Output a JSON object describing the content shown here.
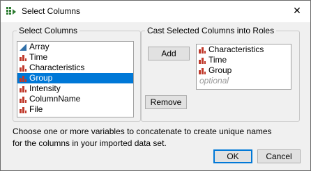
{
  "window": {
    "title": "Select Columns",
    "close_glyph": "✕"
  },
  "select_columns": {
    "label": "Select Columns",
    "items": [
      {
        "label": "Array",
        "icon": "continuous-column-icon",
        "selected": false
      },
      {
        "label": "Time",
        "icon": "nominal-column-icon",
        "selected": false
      },
      {
        "label": "Characteristics",
        "icon": "nominal-column-icon",
        "selected": false
      },
      {
        "label": "Group",
        "icon": "nominal-column-icon",
        "selected": true
      },
      {
        "label": "Intensity",
        "icon": "nominal-column-icon",
        "selected": false
      },
      {
        "label": "ColumnName",
        "icon": "nominal-column-icon",
        "selected": false
      },
      {
        "label": "File",
        "icon": "nominal-column-icon",
        "selected": false
      }
    ]
  },
  "roles": {
    "label": "Cast Selected Columns into Roles",
    "add_label": "Add",
    "remove_label": "Remove",
    "items": [
      {
        "label": "Characteristics",
        "icon": "nominal-column-icon"
      },
      {
        "label": "Time",
        "icon": "nominal-column-icon"
      },
      {
        "label": "Group",
        "icon": "nominal-column-icon"
      }
    ],
    "placeholder": "optional"
  },
  "info_text": "Choose one or more variables to concatenate to create unique names for the columns in your imported data set.",
  "buttons": {
    "ok": "OK",
    "cancel": "Cancel"
  },
  "colors": {
    "accent": "#0078d7",
    "nominal_icon": "#c0392b",
    "continuous_icon": "#2f6fa8"
  }
}
